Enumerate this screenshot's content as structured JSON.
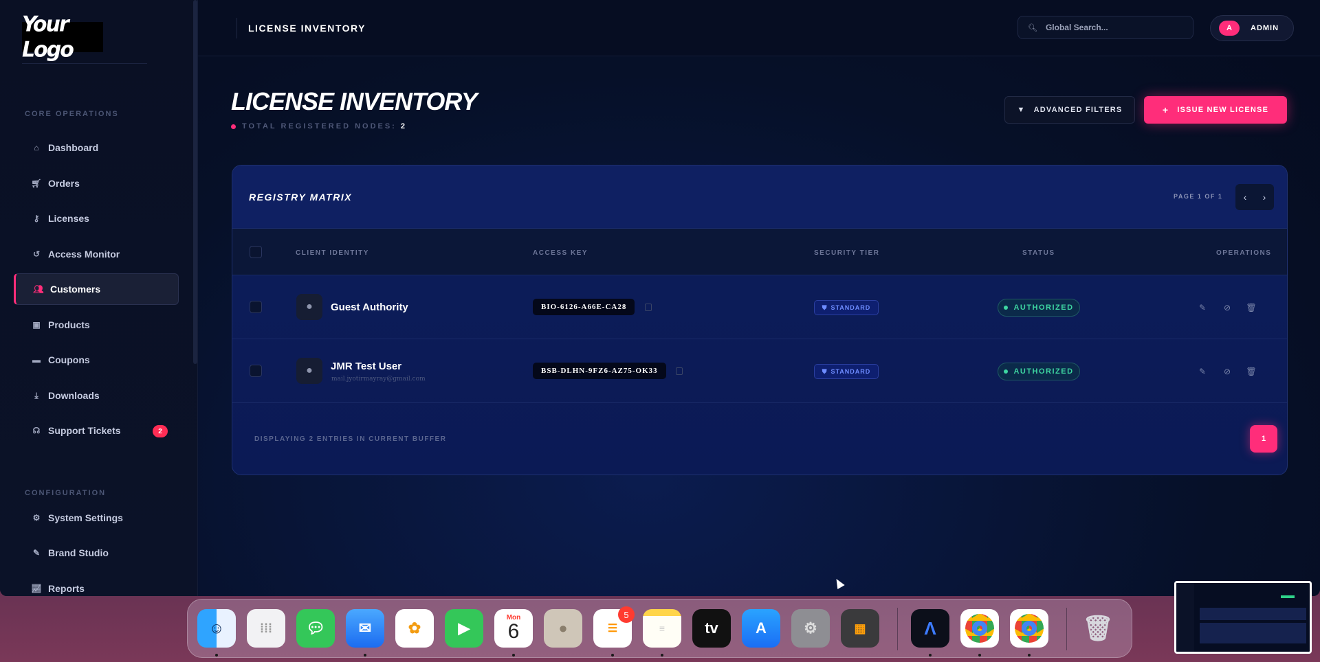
{
  "logo": {
    "text": "Your Logo"
  },
  "sidebar": {
    "section_core": "CORE OPERATIONS",
    "section_config": "CONFIGURATION",
    "items": [
      {
        "label": "Dashboard",
        "icon": "home-icon"
      },
      {
        "label": "Orders",
        "icon": "cart-icon"
      },
      {
        "label": "Licenses",
        "icon": "key-icon"
      },
      {
        "label": "Access Monitor",
        "icon": "history-icon"
      },
      {
        "label": "Customers",
        "icon": "users-icon",
        "active": true
      },
      {
        "label": "Products",
        "icon": "box-icon"
      },
      {
        "label": "Coupons",
        "icon": "ticket-icon"
      },
      {
        "label": "Downloads",
        "icon": "download-icon"
      },
      {
        "label": "Support Tickets",
        "icon": "headset-icon",
        "badge": "2"
      }
    ],
    "config_items": [
      {
        "label": "System Settings",
        "icon": "gear-icon"
      },
      {
        "label": "Brand Studio",
        "icon": "brush-icon"
      },
      {
        "label": "Reports",
        "icon": "chart-icon"
      }
    ]
  },
  "topbar": {
    "title": "LICENSE INVENTORY",
    "search_placeholder": "Global Search...",
    "avatar_letter": "A",
    "user_name": "ADMIN"
  },
  "page": {
    "title": "LICENSE INVENTORY",
    "total_label": "TOTAL REGISTERED NODES:",
    "total_count": "2",
    "filters_button": "ADVANCED FILTERS",
    "issue_button": "ISSUE NEW LICENSE"
  },
  "table": {
    "title": "REGISTRY MATRIX",
    "page_info": "PAGE 1 OF 1",
    "columns": [
      "CLIENT IDENTITY",
      "ACCESS KEY",
      "SECURITY TIER",
      "STATUS",
      "OPERATIONS"
    ],
    "rows": [
      {
        "name": "Guest Authority",
        "email": "",
        "key": "BIO-6126-A66E-CA28",
        "tier": "STANDARD",
        "status": "AUTHORIZED"
      },
      {
        "name": "JMR Test User",
        "email": "mail.jyotirmayray@gmail.com",
        "key": "BSB-DLHN-9FZ6-AZ75-OK33",
        "tier": "STANDARD",
        "status": "AUTHORIZED"
      }
    ],
    "footer": "DISPLAYING 2 ENTRIES IN CURRENT BUFFER",
    "current_page": "1"
  },
  "dock": {
    "calendar_month": "Mon",
    "calendar_day": "6",
    "reminders_badge": "5",
    "tv_label": "tv"
  },
  "colors": {
    "accent": "#ff2d7a",
    "status_green": "#3ed6a2",
    "tier_blue": "#6e8cff"
  }
}
